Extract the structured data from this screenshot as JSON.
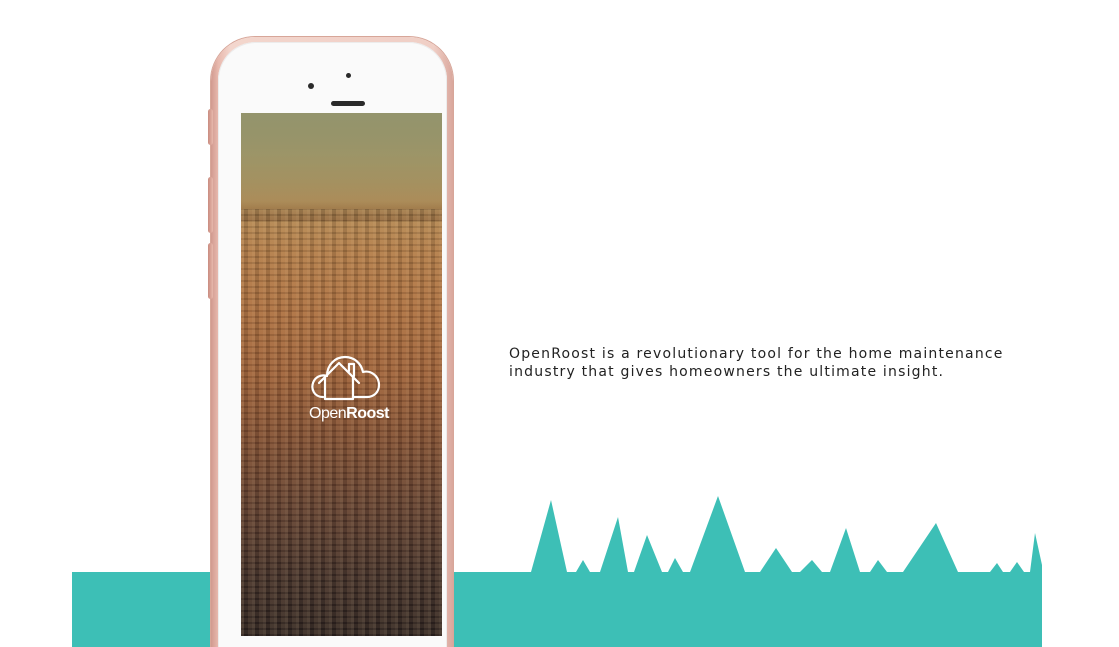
{
  "brand": {
    "name_part1": "Open",
    "name_part2": "Roost"
  },
  "description": "OpenRoost is a revolutionary tool for the home maintenance industry that gives homeowners the ultimate insight.",
  "colors": {
    "teal": "#3dbfb6",
    "phone_rose_gold": "#f0cfc6",
    "text": "#222222"
  },
  "icons": [
    "cloud-house-logo-icon"
  ]
}
